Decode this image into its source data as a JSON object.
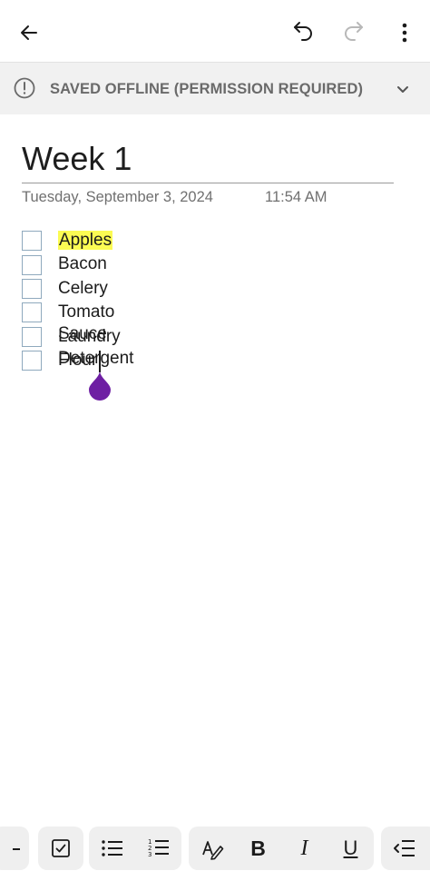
{
  "note": {
    "title": "Week 1",
    "date": "Tuesday, September 3, 2024",
    "time": "11:54 AM"
  },
  "banner": {
    "text": "SAVED OFFLINE (PERMISSION REQUIRED)"
  },
  "checklist": [
    {
      "text": "Apples",
      "checked": false,
      "highlighted": true
    },
    {
      "text": "Bacon",
      "checked": false,
      "highlighted": false
    },
    {
      "text": "Celery",
      "checked": false,
      "highlighted": false
    },
    {
      "text": "Tomato Sauce",
      "checked": false,
      "highlighted": false
    },
    {
      "text": "Laundry Detergent",
      "checked": false,
      "highlighted": false
    },
    {
      "text": "Flour",
      "checked": false,
      "highlighted": false
    }
  ],
  "toolbar": {
    "bold_label": "B",
    "italic_label": "I",
    "underline_label": "U",
    "icons": [
      "dash-icon",
      "checkbox-icon",
      "bullet-list-icon",
      "numbered-list-icon",
      "highlighter-icon",
      "bold-icon",
      "italic-icon",
      "underline-icon",
      "outdent-icon"
    ]
  },
  "colors": {
    "highlight": "#fbfb53",
    "selection_handle": "#6e1fa3",
    "banner_bg": "#f1f1f1",
    "checkbox_border": "#8fa9bd"
  }
}
